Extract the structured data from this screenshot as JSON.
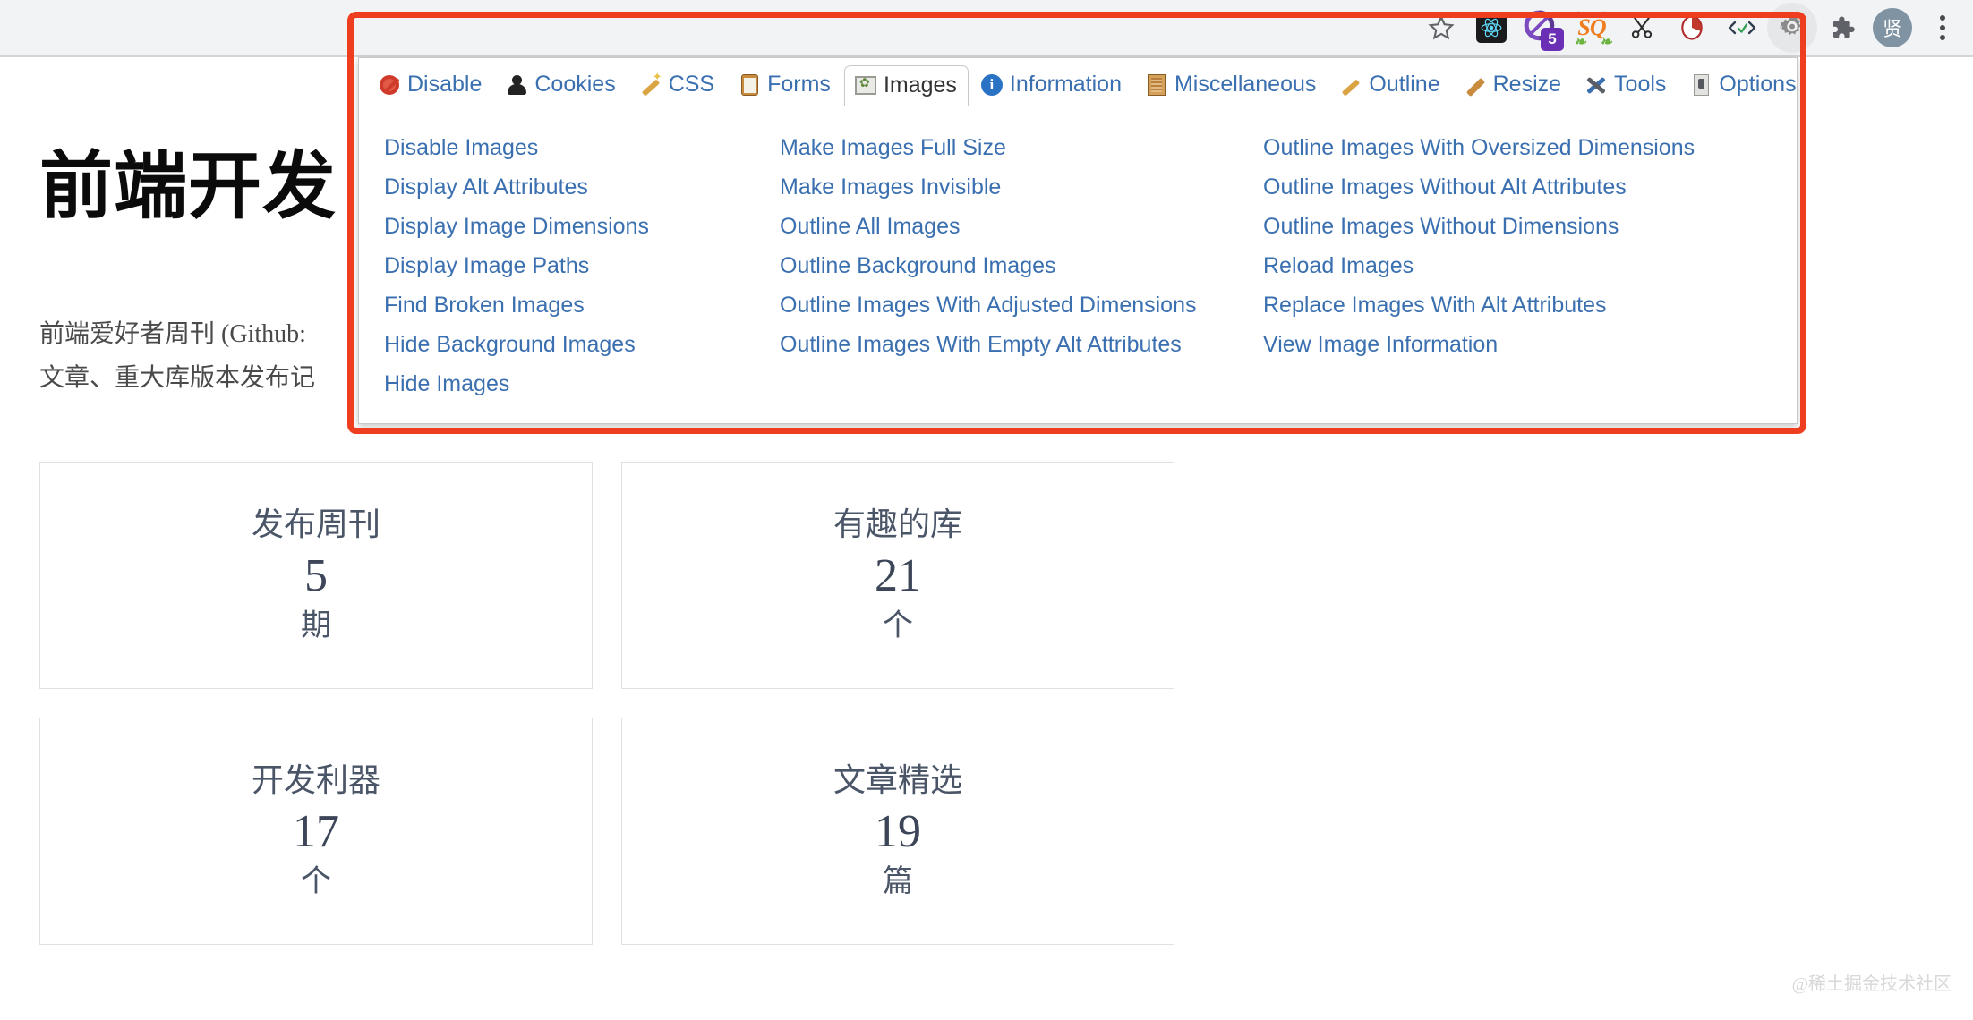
{
  "browser": {
    "toolbar_icons": [
      {
        "name": "bookmark-star-icon",
        "label": "Bookmark"
      },
      {
        "name": "react-devtools-icon",
        "label": "React Developer Tools"
      },
      {
        "name": "purple-extension-icon",
        "label": "Extension",
        "badge": "5"
      },
      {
        "name": "sq-extension-icon",
        "label": "SQ"
      },
      {
        "name": "scissors-icon",
        "label": "Clip"
      },
      {
        "name": "pie-timer-icon",
        "label": "Timer"
      },
      {
        "name": "code-check-icon",
        "label": "Code"
      },
      {
        "name": "web-developer-gear-icon",
        "label": "Web Developer"
      },
      {
        "name": "extensions-puzzle-icon",
        "label": "Extensions"
      }
    ],
    "avatar_label": "贤",
    "menu_icon": "kebab-menu-icon"
  },
  "page": {
    "title": "前端开发",
    "paragraph_lines": [
      "前端爱好者周刊 (Github:",
      "文章、重大库版本发布记"
    ],
    "watermark": "@稀土掘金技术社区",
    "cards": [
      {
        "title": "发布周刊",
        "number": "5",
        "unit": "期"
      },
      {
        "title": "有趣的库",
        "number": "21",
        "unit": "个"
      },
      {
        "title": "开发利器",
        "number": "17",
        "unit": "个"
      },
      {
        "title": "文章精选",
        "number": "19",
        "unit": "篇"
      }
    ]
  },
  "webdev_popup": {
    "tabs": [
      {
        "label": "Disable",
        "icon": "disable-icon",
        "active": false
      },
      {
        "label": "Cookies",
        "icon": "cookies-icon",
        "active": false
      },
      {
        "label": "CSS",
        "icon": "css-icon",
        "active": false
      },
      {
        "label": "Forms",
        "icon": "forms-icon",
        "active": false
      },
      {
        "label": "Images",
        "icon": "images-icon",
        "active": true
      },
      {
        "label": "Information",
        "icon": "information-icon",
        "active": false
      },
      {
        "label": "Miscellaneous",
        "icon": "miscellaneous-icon",
        "active": false
      },
      {
        "label": "Outline",
        "icon": "outline-icon",
        "active": false
      },
      {
        "label": "Resize",
        "icon": "resize-icon",
        "active": false
      },
      {
        "label": "Tools",
        "icon": "tools-icon",
        "active": false
      },
      {
        "label": "Options",
        "icon": "options-icon",
        "active": false
      }
    ],
    "columns": [
      [
        "Disable Images",
        "Display Alt Attributes",
        "Display Image Dimensions",
        "Display Image Paths",
        "Find Broken Images",
        "Hide Background Images",
        "Hide Images"
      ],
      [
        "Make Images Full Size",
        "Make Images Invisible",
        "Outline All Images",
        "Outline Background Images",
        "Outline Images With Adjusted Dimensions",
        "Outline Images With Empty Alt Attributes"
      ],
      [
        "Outline Images With Oversized Dimensions",
        "Outline Images Without Alt Attributes",
        "Outline Images Without Dimensions",
        "Reload Images",
        "Replace Images With Alt Attributes",
        "View Image Information"
      ]
    ]
  },
  "annotation": {
    "name": "red-highlight-rectangle",
    "color": "#ef3d1f"
  }
}
